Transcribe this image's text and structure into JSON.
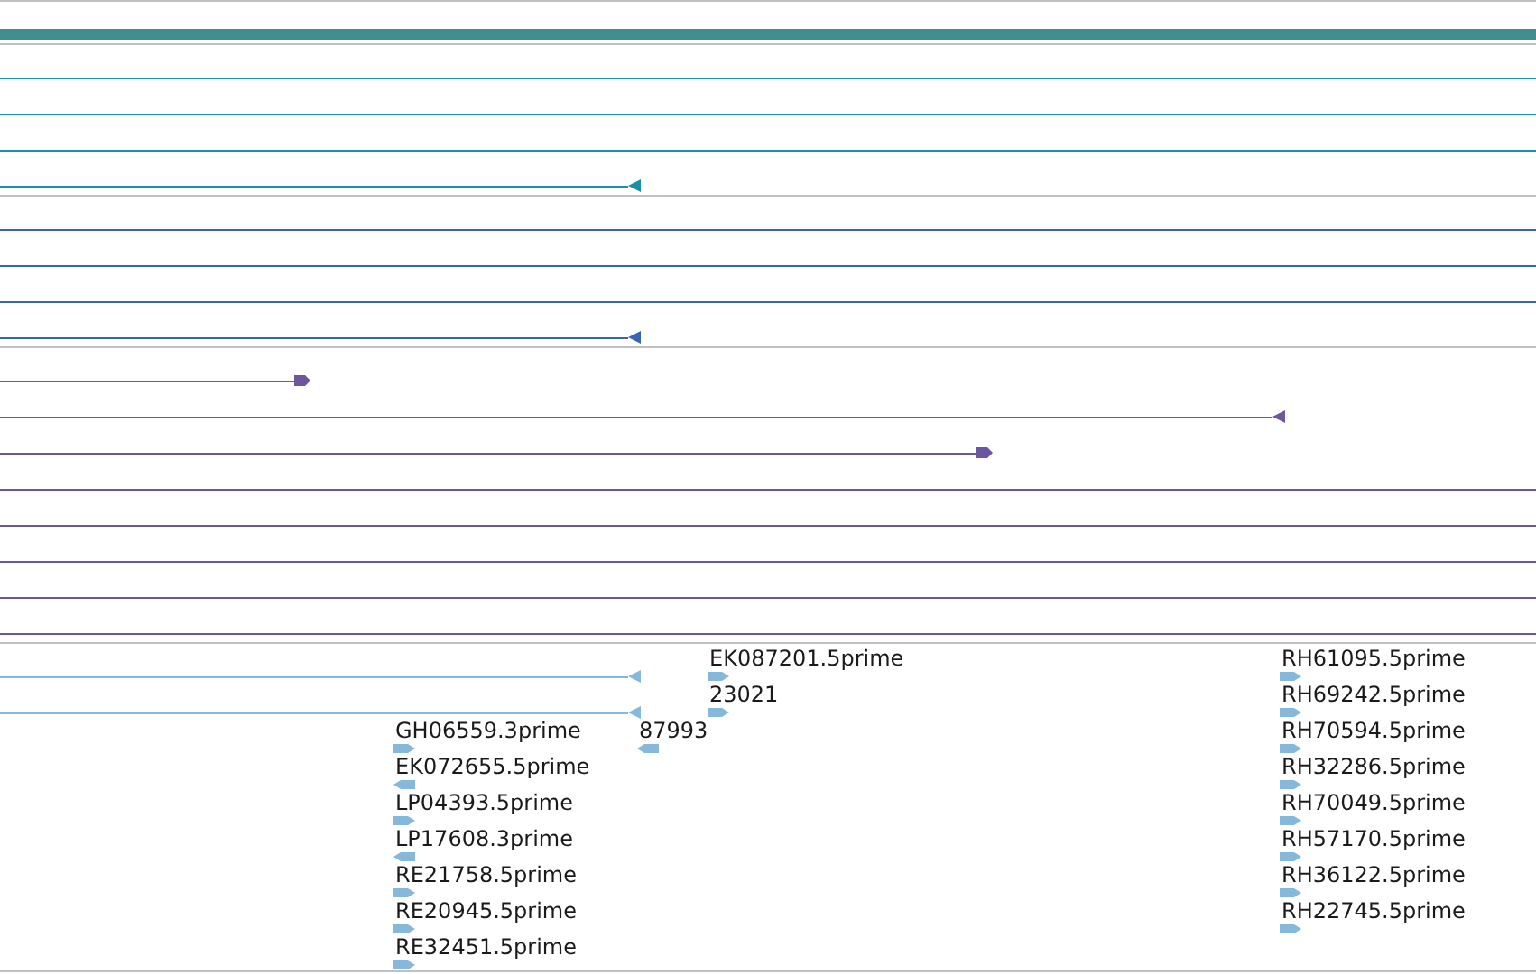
{
  "header_bar": {
    "color": "#3f8f91"
  },
  "tracks": [
    {
      "color": "#1a8fa8",
      "lanes": [
        {
          "kind": "plain"
        },
        {
          "kind": "plain"
        },
        {
          "kind": "plain"
        },
        {
          "kind": "reverse"
        }
      ]
    },
    {
      "color": "#3a66b0",
      "lanes": [
        {
          "kind": "plain"
        },
        {
          "kind": "plain"
        },
        {
          "kind": "plain"
        },
        {
          "kind": "reverse"
        }
      ]
    },
    {
      "color": "#6e55a0",
      "lanes": [
        {
          "kind": "forward"
        },
        {
          "kind": "reverse"
        },
        {
          "kind": "forward"
        },
        {
          "kind": "plain"
        },
        {
          "kind": "plain"
        },
        {
          "kind": "plain"
        },
        {
          "kind": "plain"
        },
        {
          "kind": "plain"
        }
      ]
    },
    {
      "color": "#86b8dc",
      "lanes": [
        {
          "kind": "reverse"
        },
        {
          "kind": "reverse"
        }
      ],
      "stacks": [
        [
          {
            "label": "GH06559.3prime",
            "kind": "forward"
          },
          {
            "label": "EK072655.5prime",
            "kind": "reverse"
          },
          {
            "label": "LP04393.5prime",
            "kind": "forward"
          },
          {
            "label": "LP17608.3prime",
            "kind": "reverse"
          },
          {
            "label": "RE21758.5prime",
            "kind": "forward"
          },
          {
            "label": "RE20945.5prime",
            "kind": "forward"
          },
          {
            "label": "RE32451.5prime",
            "kind": "forward"
          }
        ],
        [
          {
            "label": "87993",
            "kind": "reverse"
          }
        ],
        [
          {
            "label": "EK087201.5prime",
            "kind": "forward"
          },
          {
            "label": "23021",
            "kind": "forward"
          }
        ],
        [
          {
            "label": "RH61095.5prime",
            "kind": "forward"
          },
          {
            "label": "RH69242.5prime",
            "kind": "forward"
          },
          {
            "label": "RH70594.5prime",
            "kind": "forward"
          },
          {
            "label": "RH32286.5prime",
            "kind": "forward"
          },
          {
            "label": "RH70049.5prime",
            "kind": "forward"
          },
          {
            "label": "RH57170.5prime",
            "kind": "forward"
          },
          {
            "label": "RH36122.5prime",
            "kind": "forward"
          },
          {
            "label": "RH22745.5prime",
            "kind": "forward"
          }
        ]
      ]
    }
  ]
}
